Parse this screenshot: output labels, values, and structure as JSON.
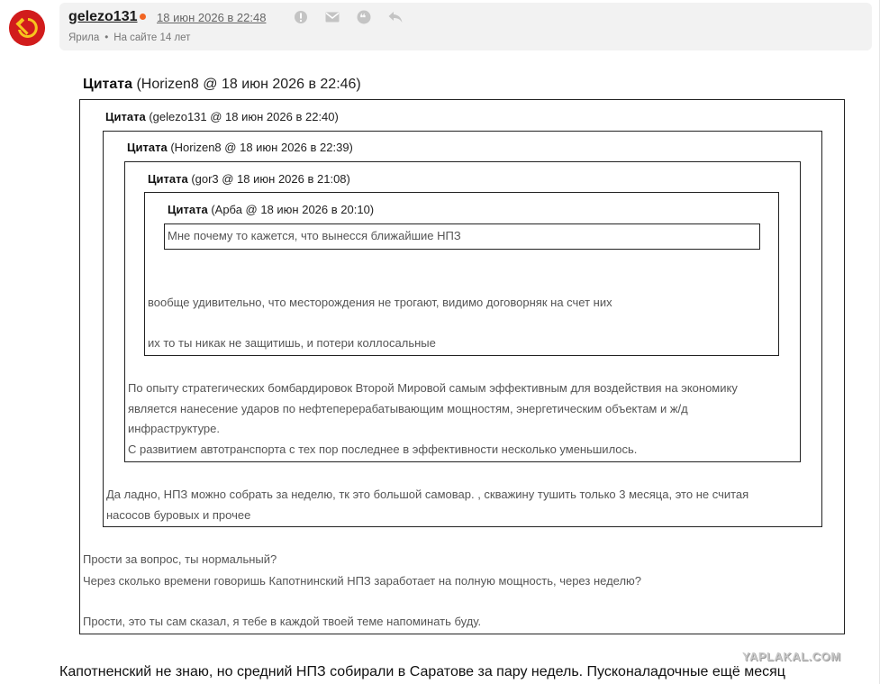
{
  "post": {
    "username": "gelezo131",
    "date": "18 июн 2026 в 22:48",
    "rank": "Ярила",
    "on_site": "На сайте 14 лет"
  },
  "icons": {
    "avatar": "hammer-sickle-icon",
    "report": "exclamation-icon",
    "message": "envelope-icon",
    "quote": "quote-icon",
    "reply": "reply-arrow-icon"
  },
  "quotes": {
    "label": "Цитата",
    "q1": {
      "meta": "(Horizen8 @ 18 июн 2026 в 22:46)",
      "lines": [
        "Прости за вопрос, ты нормальный?",
        "Через сколько времени говоришь Капотнинский НПЗ заработает на полную мощность, через неделю?",
        "Прости, это ты сам сказал, я тебе в каждой твоей теме напоминать буду."
      ]
    },
    "q2": {
      "meta": "(gelezo131 @ 18 июн 2026 в 22:40)",
      "lines": [
        "Да ладно, НПЗ можно собрать за неделю, тк это большой самовар. , скважину тушить только 3 месяца, это не считая",
        "насосов буровых и прочее"
      ]
    },
    "q3": {
      "meta": "(Horizen8 @ 18 июн 2026 в 22:39)",
      "lines": [
        "По опыту стратегических бомбардировок Второй Мировой самым эффективным для воздействия на экономику",
        "является нанесение ударов по нефтеперерабатывающим мощностям, энергетическим объектам и ж/д",
        "инфраструктуре.",
        "С развитием автотранспорта с тех пор последнее в эффективности несколько уменьшилось."
      ]
    },
    "q4": {
      "meta": "(gor3 @ 18 июн 2026 в 21:08)",
      "lines": [
        "вообще удивительно, что месторождения не трогают, видимо договорняк на счет них",
        "их то ты никак не защитишь, и потери коллосальные"
      ]
    },
    "q5": {
      "meta": "(Арба @ 18 июн 2026 в 20:10)",
      "lines": [
        "Мне почему то кажется, что вынесся ближайшие НПЗ"
      ]
    }
  },
  "reply_text": "Капотненский не знаю, но средний НПЗ собирали в Саратове за пару недель. Пусконаладочные ещё месяц",
  "watermark": "YAPLAKAL.COM"
}
